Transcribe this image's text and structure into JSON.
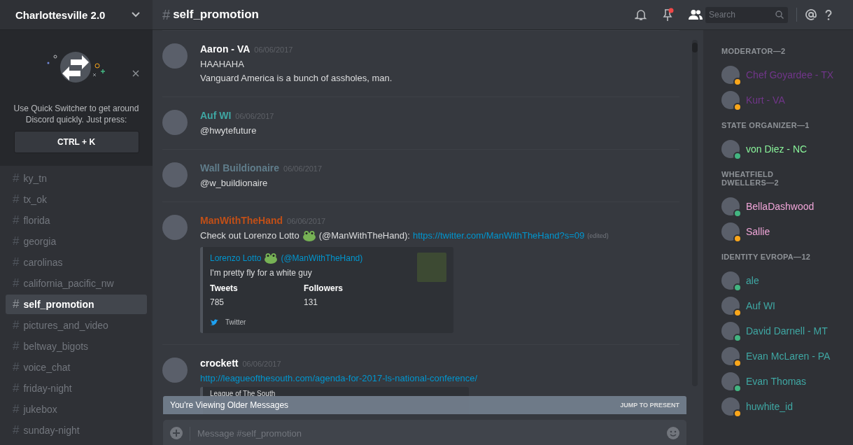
{
  "server": {
    "name": "Charlottesville 2.0"
  },
  "quick_switcher": {
    "text": "Use Quick Switcher to get around Discord quickly. Just press:",
    "shortcut": "CTRL + K"
  },
  "channels": [
    {
      "name": "ky_tn",
      "selected": false
    },
    {
      "name": "tx_ok",
      "selected": false
    },
    {
      "name": "florida",
      "selected": false
    },
    {
      "name": "georgia",
      "selected": false
    },
    {
      "name": "carolinas",
      "selected": false
    },
    {
      "name": "california_pacific_nw",
      "selected": false
    },
    {
      "name": "self_promotion",
      "selected": true
    },
    {
      "name": "pictures_and_video",
      "selected": false
    },
    {
      "name": "beltway_bigots",
      "selected": false
    },
    {
      "name": "voice_chat",
      "selected": false
    },
    {
      "name": "friday-night",
      "selected": false
    },
    {
      "name": "jukebox",
      "selected": false
    },
    {
      "name": "sunday-night",
      "selected": false
    }
  ],
  "header": {
    "hash": "#",
    "channel": "self_promotion",
    "pins_unread": true,
    "search": {
      "placeholder": "Search"
    }
  },
  "messages": [
    {
      "author": "Aaron - VA",
      "color": "#ffffff",
      "time": "06/06/2017",
      "lines": [
        "HAAHAHA",
        "Vanguard America is a bunch of assholes, man."
      ]
    },
    {
      "author": "Auf WI",
      "color": "#3fa7a3",
      "time": "06/06/2017",
      "lines": [
        "@hwytefuture"
      ]
    },
    {
      "author": "Wall Buildionaire",
      "color": "#607d8b",
      "time": "06/06/2017",
      "lines": [
        "@w_buildionaire"
      ]
    },
    {
      "author": "ManWithTheHand",
      "color": "#c14f17",
      "time": "06/06/2017",
      "text_before": "Check out Lorenzo Lotto",
      "text_after": "(@ManWithTheHand):",
      "link": "https://twitter.com/ManWithTheHand?s=09",
      "edited": "(edited)",
      "embed": {
        "author_before": "Lorenzo Lotto",
        "author_after": "(@ManWithTheHand)",
        "description": "I'm pretty fly for a white guy",
        "fields": [
          {
            "name": "Tweets",
            "value": "785"
          },
          {
            "name": "Followers",
            "value": "131"
          }
        ],
        "footer": "Twitter"
      }
    },
    {
      "author": "crockett",
      "color": "#ffffff",
      "time": "06/06/2017",
      "link": "http://leagueofthesouth.com/agenda-for-2017-ls-national-conference/",
      "embed": {
        "provider": "League of The South"
      }
    }
  ],
  "older_bar": {
    "text": "You're Viewing Older Messages",
    "action": "JUMP TO PRESENT"
  },
  "composer": {
    "placeholder": "Message #self_promotion"
  },
  "member_groups": [
    {
      "title": "MODERATOR—2",
      "members": [
        {
          "name": "Chef Goyardee - TX",
          "color": "#71368a",
          "idle": true
        },
        {
          "name": "Kurt - VA",
          "color": "#71368a",
          "idle": true
        }
      ]
    },
    {
      "title": "STATE ORGANIZER—1",
      "members": [
        {
          "name": "von Diez - NC",
          "color": "#8af59b",
          "idle": false
        }
      ]
    },
    {
      "title": "WHEATFIELD DWELLERS—2",
      "members": [
        {
          "name": "BellaDashwood",
          "color": "#f0a5d8",
          "idle": false
        },
        {
          "name": "Sallie",
          "color": "#f0a5d8",
          "idle": true
        }
      ]
    },
    {
      "title": "IDENTITY EVROPA—12",
      "members": [
        {
          "name": "ale",
          "color": "#3fa7a3",
          "idle": false
        },
        {
          "name": "Auf WI",
          "color": "#3fa7a3",
          "idle": true
        },
        {
          "name": "David Darnell - MT",
          "color": "#3fa7a3",
          "idle": false
        },
        {
          "name": "Evan McLaren - PA",
          "color": "#3fa7a3",
          "idle": true
        },
        {
          "name": "Evan Thomas",
          "color": "#3fa7a3",
          "idle": false
        },
        {
          "name": "huwhite_id",
          "color": "#3fa7a3",
          "idle": true
        }
      ]
    }
  ]
}
